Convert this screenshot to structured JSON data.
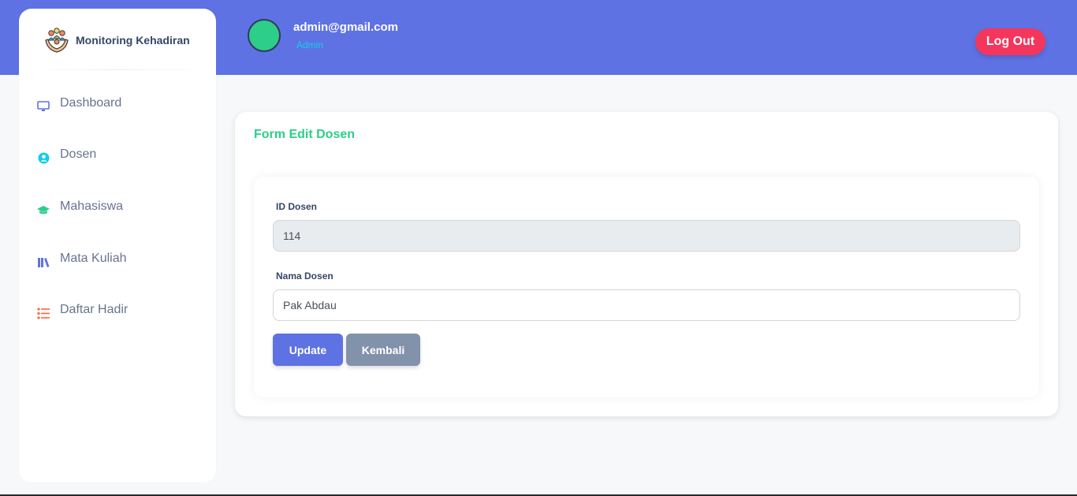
{
  "brand": {
    "name": "Monitoring Kehadiran",
    "logo_icon": "hands-people-icon"
  },
  "sidebar": {
    "items": [
      {
        "label": "Dashboard",
        "icon": "monitor-icon",
        "color": "#5e72e4"
      },
      {
        "label": "Dosen",
        "icon": "user-circle-icon",
        "color": "#11cdef"
      },
      {
        "label": "Mahasiswa",
        "icon": "graduation-cap-icon",
        "color": "#2dce89"
      },
      {
        "label": "Mata Kuliah",
        "icon": "books-icon",
        "color": "#5e72e4"
      },
      {
        "label": "Daftar Hadir",
        "icon": "list-icon",
        "color": "#fb6340"
      }
    ]
  },
  "header": {
    "email": "admin@gmail.com",
    "role": "Admin",
    "logout_label": "Log Out"
  },
  "form": {
    "title": "Form Edit Dosen",
    "id_label": "ID Dosen",
    "id_value": "114",
    "name_label": "Nama Dosen",
    "name_value": "Pak Abdau",
    "update_label": "Update",
    "back_label": "Kembali"
  },
  "colors": {
    "primary": "#5e72e4",
    "success": "#2dce89",
    "danger": "#f5365c",
    "secondary": "#8392ab"
  }
}
